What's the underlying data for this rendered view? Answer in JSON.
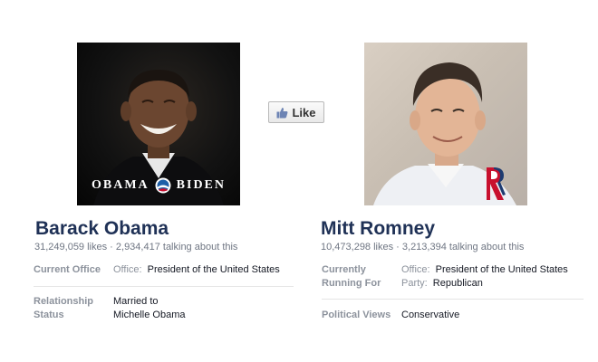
{
  "like_button": {
    "label": "Like",
    "icon": "thumbs-up-icon"
  },
  "left": {
    "name": "Barack Obama",
    "stats": "31,249,059 likes · 2,934,417 talking about this",
    "photo_logo": {
      "left": "OBAMA",
      "right": "BIDEN"
    },
    "fields": [
      {
        "label": "Current Office",
        "key": "Office:",
        "value": "President of the United States"
      },
      {
        "label": "Relationship Status",
        "value_line1": "Married to",
        "value_line2": "Michelle Obama"
      }
    ]
  },
  "right": {
    "name": "Mitt Romney",
    "stats": "10,473,298 likes · 3,213,394 talking about this",
    "fields": [
      {
        "label": "Currently Running For",
        "key1": "Office:",
        "value1": "President of the United States",
        "key2": "Party:",
        "value2": "Republican"
      },
      {
        "label": "Political Views",
        "value": "Conservative"
      }
    ]
  },
  "colors": {
    "name": "#1f3156",
    "muted": "#8c929c",
    "romney_logo_red": "#c8102e",
    "romney_logo_blue": "#1d3a70"
  }
}
